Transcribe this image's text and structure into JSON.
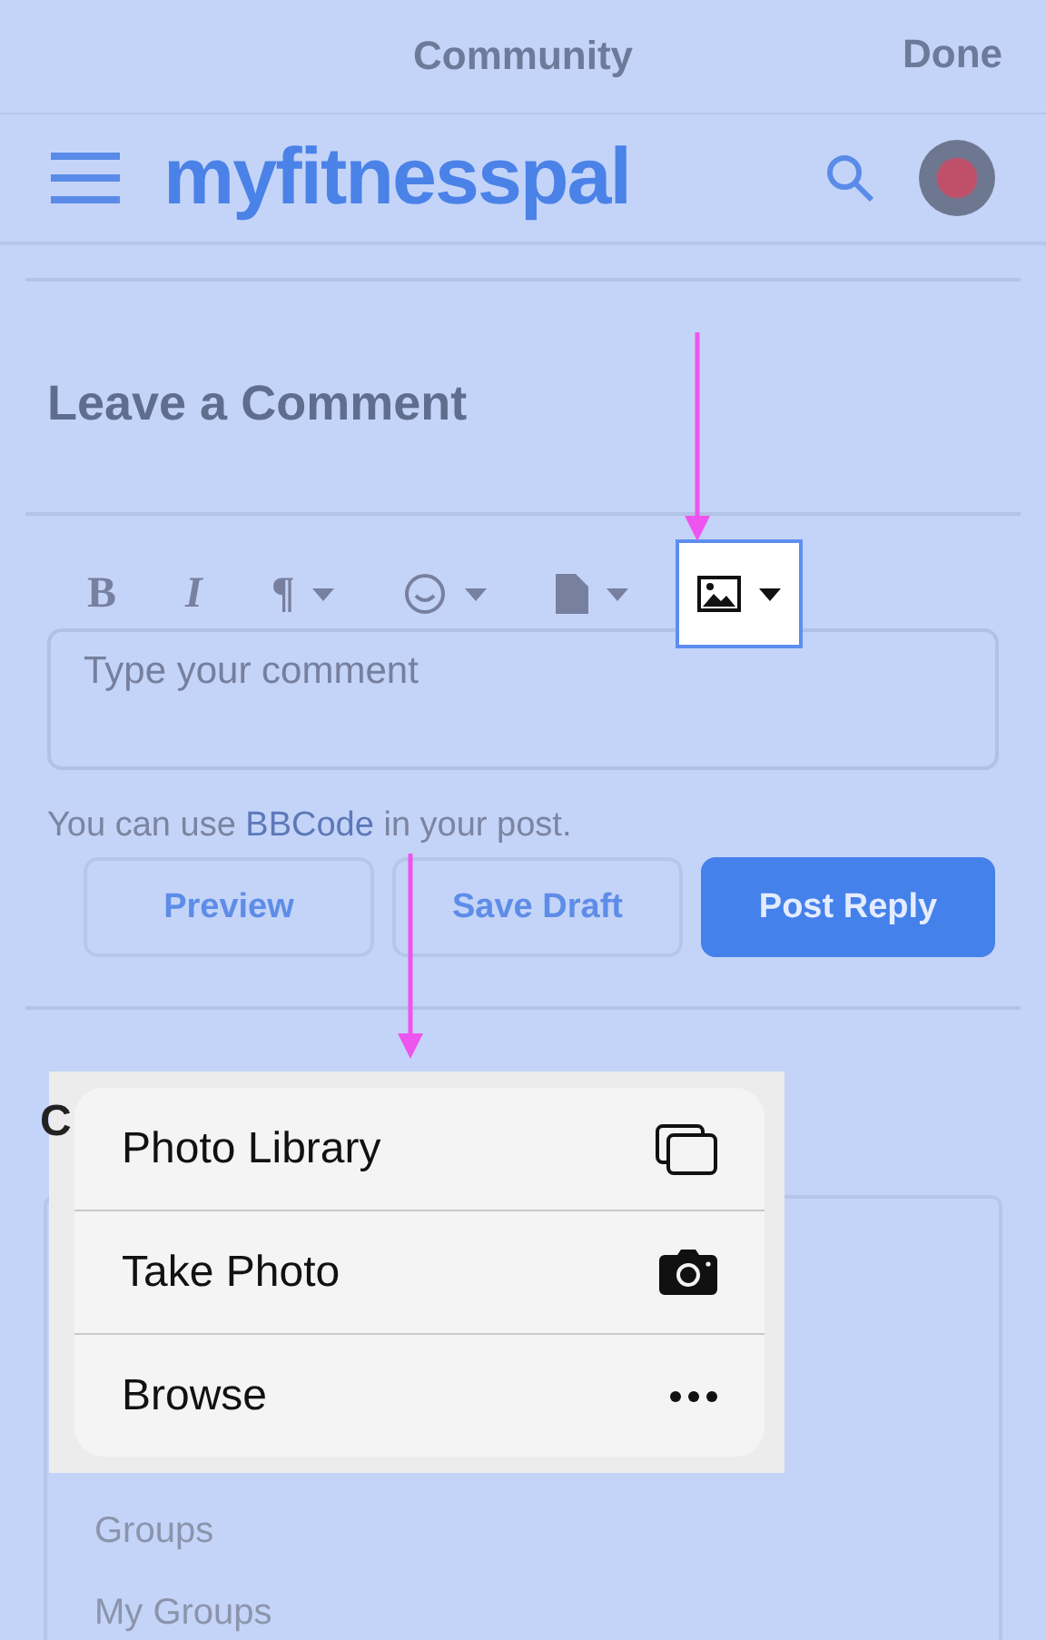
{
  "top_bar": {
    "title": "Community",
    "done": "Done"
  },
  "nav": {
    "logo": "myfitnesspal"
  },
  "comment": {
    "heading": "Leave a Comment",
    "toolbar": [
      {
        "kind": "bold",
        "label": "B",
        "dropdown": false,
        "selected": false
      },
      {
        "kind": "italic",
        "label": "I",
        "dropdown": false,
        "selected": false
      },
      {
        "kind": "paragraph",
        "label": "¶",
        "dropdown": true,
        "selected": false
      },
      {
        "kind": "emoji",
        "dropdown": true,
        "selected": false
      },
      {
        "kind": "file",
        "dropdown": true,
        "selected": false
      },
      {
        "kind": "image",
        "dropdown": true,
        "selected": true
      }
    ],
    "placeholder": "Type your comment",
    "hint": {
      "before": "You can use ",
      "link": "BBCode",
      "after": " in your post."
    },
    "buttons": [
      {
        "label": "Preview",
        "primary": false
      },
      {
        "label": "Save Draft",
        "primary": false
      },
      {
        "label": "Post Reply",
        "primary": true
      }
    ]
  },
  "next_heading": "C",
  "sidebar_items": [
    "Groups",
    "My Groups"
  ],
  "popup_menu": [
    {
      "label": "Photo Library",
      "kind": "library"
    },
    {
      "label": "Take Photo",
      "kind": "camera"
    },
    {
      "label": "Browse",
      "kind": "more"
    }
  ]
}
